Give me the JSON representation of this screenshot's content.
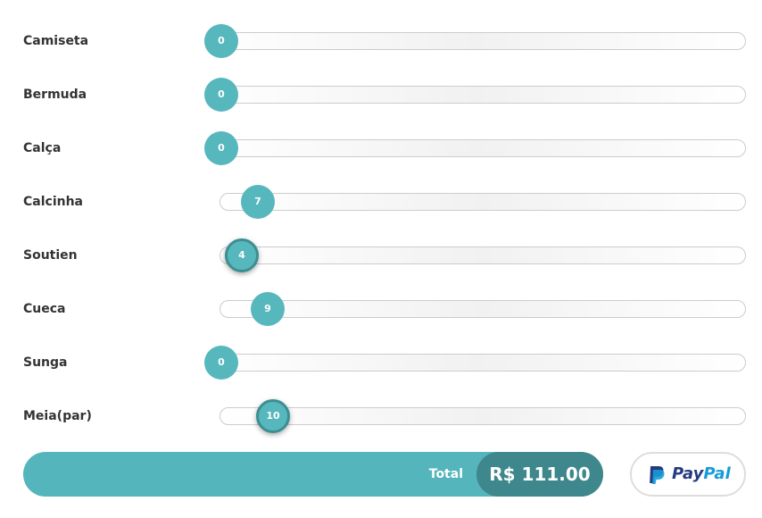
{
  "items": [
    {
      "label": "Camiseta",
      "value": "0"
    },
    {
      "label": "Bermuda",
      "value": "0"
    },
    {
      "label": "Calça",
      "value": "0"
    },
    {
      "label": "Calcinha",
      "value": "7"
    },
    {
      "label": "Soutien",
      "value": "4"
    },
    {
      "label": "Cueca",
      "value": "9"
    },
    {
      "label": "Sunga",
      "value": "0"
    },
    {
      "label": "Meia(par)",
      "value": "10"
    }
  ],
  "total": {
    "label": "Total",
    "amount": "R$ 111.00"
  },
  "paypal": {
    "brand_part1": "Pay",
    "brand_part2": "Pal",
    "icon": "paypal-icon"
  },
  "colors": {
    "accent": "#56b7bd",
    "accent_dark": "#3e878c",
    "paypal_dark": "#253b80",
    "paypal_light": "#179bd7"
  }
}
